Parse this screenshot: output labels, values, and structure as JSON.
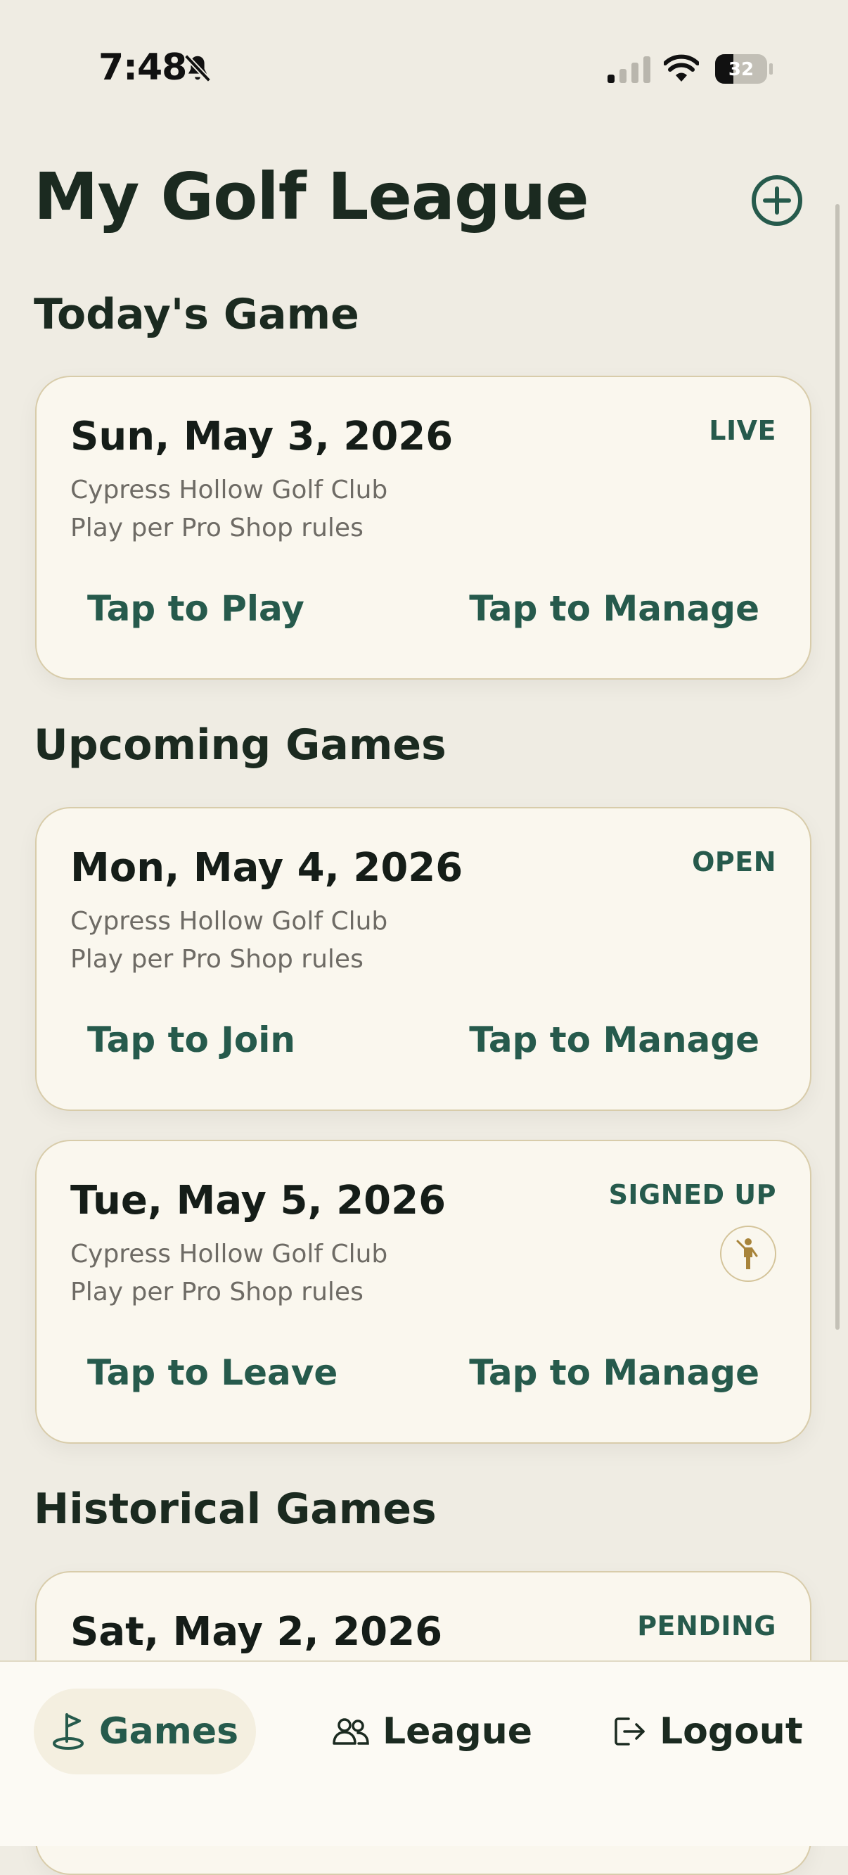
{
  "status_bar": {
    "time": "7:48",
    "battery": "32"
  },
  "header": {
    "title": "My Golf League"
  },
  "sections": {
    "today": "Today's Game",
    "upcoming": "Upcoming Games",
    "historical": "Historical Games"
  },
  "today_game": {
    "date": "Sun, May 3, 2026",
    "status": "LIVE",
    "course": "Cypress Hollow Golf Club",
    "rules": "Play per Pro Shop rules",
    "action_left": "Tap to Play",
    "action_right": "Tap to Manage"
  },
  "upcoming_games": [
    {
      "date": "Mon, May 4, 2026",
      "status": "OPEN",
      "course": "Cypress Hollow Golf Club",
      "rules": "Play per Pro Shop rules",
      "action_left": "Tap to Join",
      "action_right": "Tap to Manage"
    },
    {
      "date": "Tue, May 5, 2026",
      "status": "SIGNED UP",
      "course": "Cypress Hollow Golf Club",
      "rules": "Play per Pro Shop rules",
      "action_left": "Tap to Leave",
      "action_right": "Tap to Manage"
    }
  ],
  "historical_games": [
    {
      "date": "Sat, May 2, 2026",
      "status": "PENDING"
    }
  ],
  "tabs": {
    "games": "Games",
    "league": "League",
    "logout": "Logout"
  },
  "colors": {
    "accent": "#265a4c",
    "background": "#efece3",
    "card": "#faf7ee",
    "card_border": "#d8ccaa",
    "gold": "#a8843a"
  }
}
